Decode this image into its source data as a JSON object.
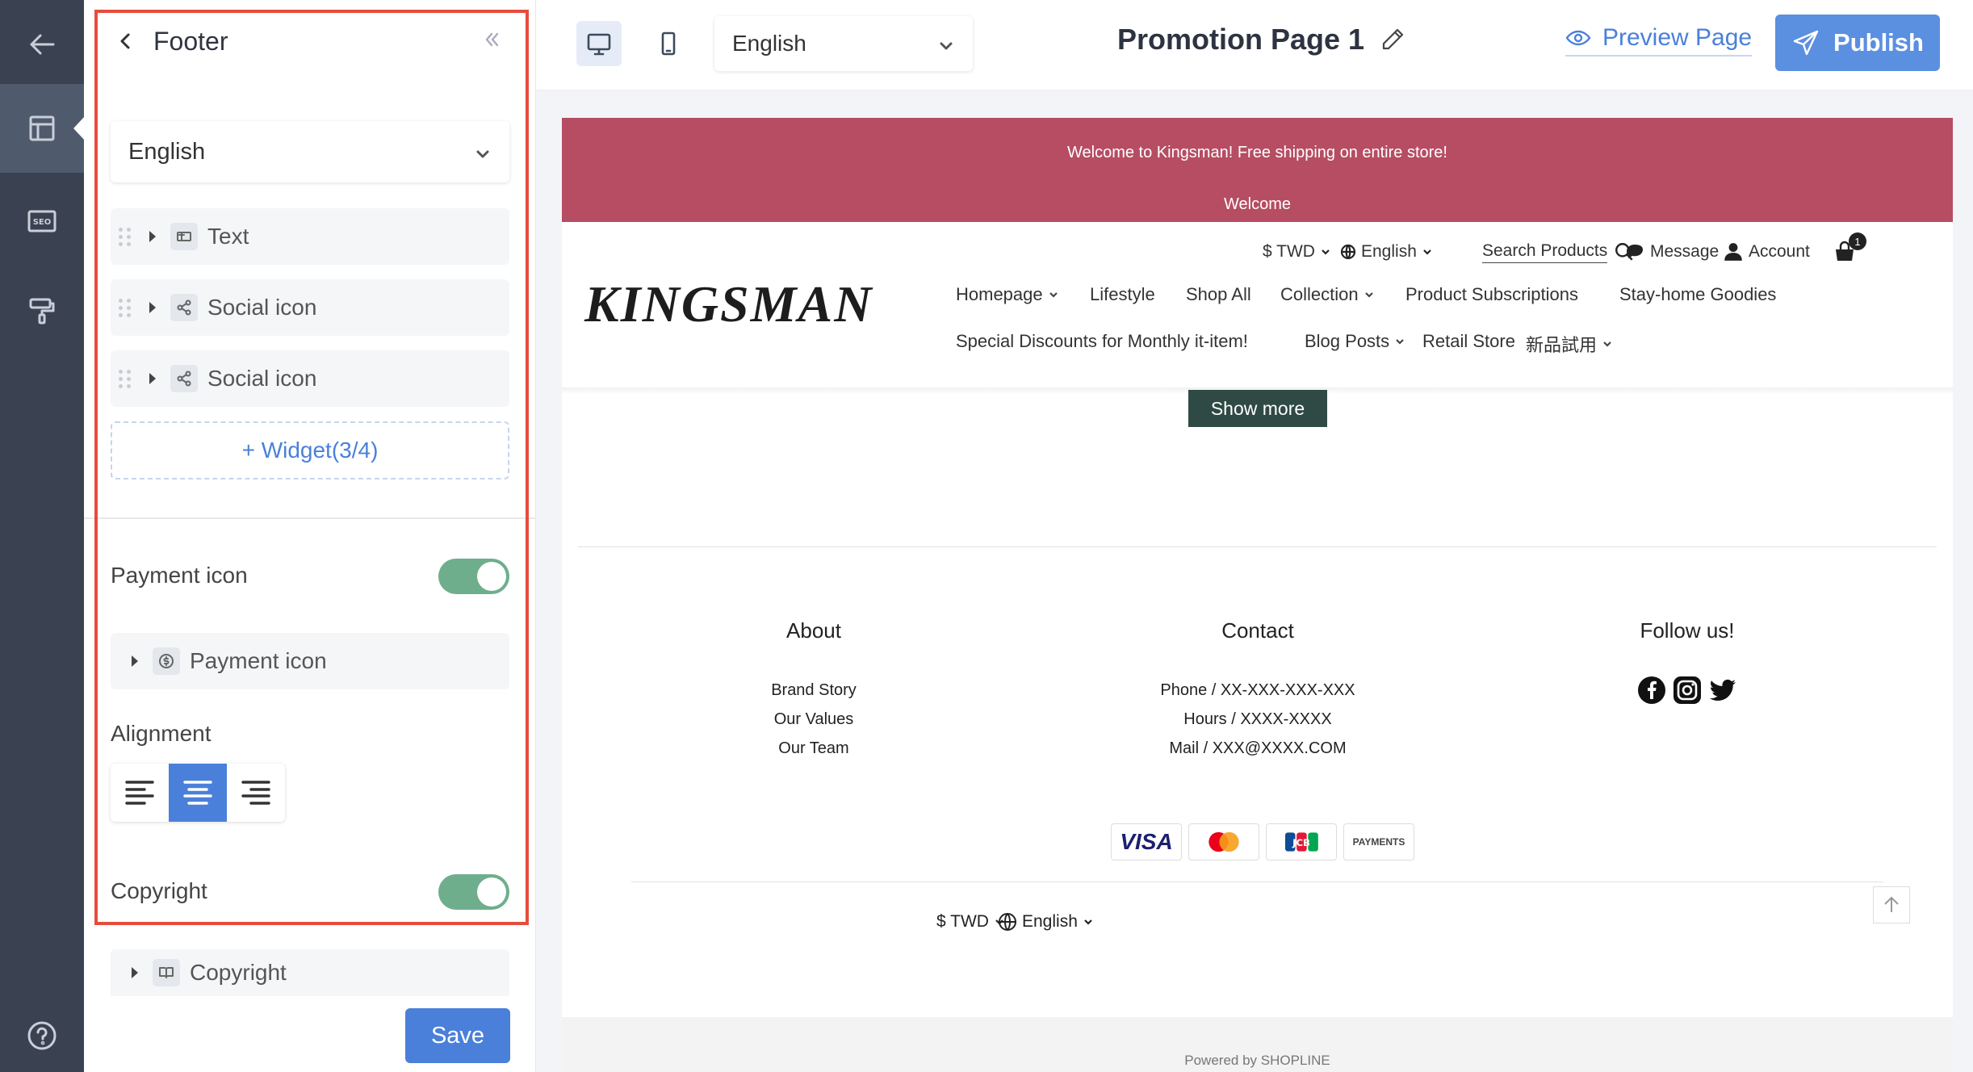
{
  "panel": {
    "title": "Footer",
    "language": "English",
    "widgets": [
      {
        "label": "Text",
        "icon": "text-widget-icon"
      },
      {
        "label": "Social icon",
        "icon": "share-icon"
      },
      {
        "label": "Social icon",
        "icon": "share-icon"
      }
    ],
    "add_widget": "+ Widget(3/4)",
    "payment_icon": {
      "label": "Payment icon",
      "enabled": true,
      "row_label": "Payment icon"
    },
    "alignment": {
      "label": "Alignment",
      "options": [
        "left",
        "center",
        "right"
      ],
      "selected": "center"
    },
    "copyright": {
      "label": "Copyright",
      "enabled": true,
      "row_label": "Copyright"
    },
    "save": "Save"
  },
  "topbar": {
    "language": "English",
    "page_title": "Promotion Page 1",
    "preview": "Preview Page",
    "publish": "Publish"
  },
  "store": {
    "announcement": [
      "Welcome to Kingsman! Free shipping on entire store!",
      "Welcome"
    ],
    "utility": {
      "currency": "$ TWD",
      "language": "English",
      "search": "Search Products",
      "message": "Message",
      "account": "Account",
      "cart_count": "1"
    },
    "logo": "KINGSMAN",
    "nav": [
      "Homepage",
      "Lifestyle",
      "Shop All",
      "Collection",
      "Product Subscriptions",
      "Stay-home Goodies",
      "Special Discounts for Monthly it-item!",
      "Blog Posts",
      "Retail Store",
      "新品試用"
    ],
    "show_more": "Show more",
    "footer": {
      "about": {
        "title": "About",
        "items": [
          "Brand Story",
          "Our Values",
          "Our Team"
        ]
      },
      "contact": {
        "title": "Contact",
        "items": [
          "Phone / XX-XXX-XXX-XXX",
          "Hours / XXXX-XXXX",
          "Mail / XXX@XXXX.COM"
        ]
      },
      "follow": {
        "title": "Follow us!"
      },
      "payments": [
        "VISA",
        "Mastercard",
        "JCB",
        "PAYMENTS"
      ],
      "currency": "$ TWD",
      "language": "English",
      "powered": "Powered by SHOPLINE"
    }
  },
  "colors": {
    "accent": "#4a80d9",
    "highlight": "#e74c3c",
    "announcement": "#b64d62",
    "toggle_on": "#6fae8c",
    "rail": "#3a4252"
  }
}
